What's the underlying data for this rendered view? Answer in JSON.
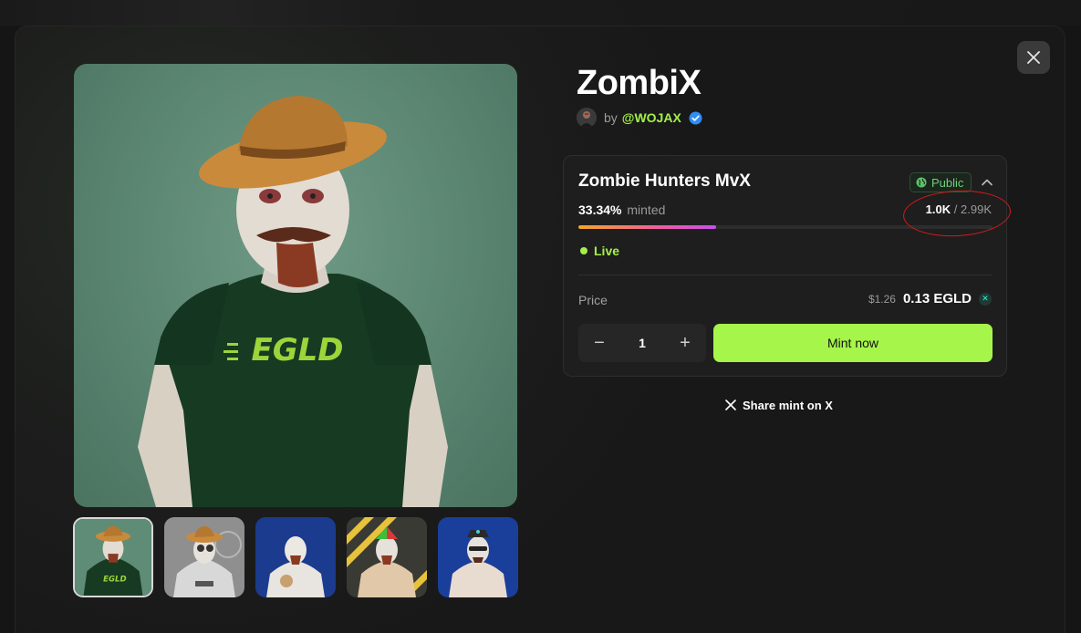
{
  "drop": {
    "title": "ZombiX",
    "by_label": "by",
    "creator_handle": "@WOJAX"
  },
  "collection": {
    "name": "Zombie Hunters MvX",
    "visibility_badge": "Public",
    "minted_percent_label": "33.34%",
    "minted_label": "minted",
    "minted_fraction": 0.3334,
    "supply_current": "1.0K",
    "supply_separator": "/",
    "supply_total": "2.99K",
    "status": "Live",
    "price_label": "Price",
    "price_usd": "$1.26",
    "price_egld": "0.13 EGLD",
    "quantity": "1",
    "mint_button": "Mint now"
  },
  "share": {
    "label": "Share mint on X"
  },
  "thumbnails": [
    {
      "label": "thumbnail-1",
      "selected": true
    },
    {
      "label": "thumbnail-2",
      "selected": false
    },
    {
      "label": "thumbnail-3",
      "selected": false
    },
    {
      "label": "thumbnail-4",
      "selected": false
    },
    {
      "label": "thumbnail-5",
      "selected": false
    }
  ],
  "colors": {
    "accent_green": "#a6f54a",
    "live_green": "#a3f04a",
    "annotation_red": "#d41a1a",
    "progress_start": "#f5a623",
    "progress_end": "#c64ff0"
  },
  "icons": {
    "close": "close-icon",
    "verified": "verified-badge-icon",
    "globe": "globe-icon",
    "collapse": "chevron-up-icon",
    "egld": "egld-token-icon",
    "x_logo": "x-logo-icon"
  }
}
